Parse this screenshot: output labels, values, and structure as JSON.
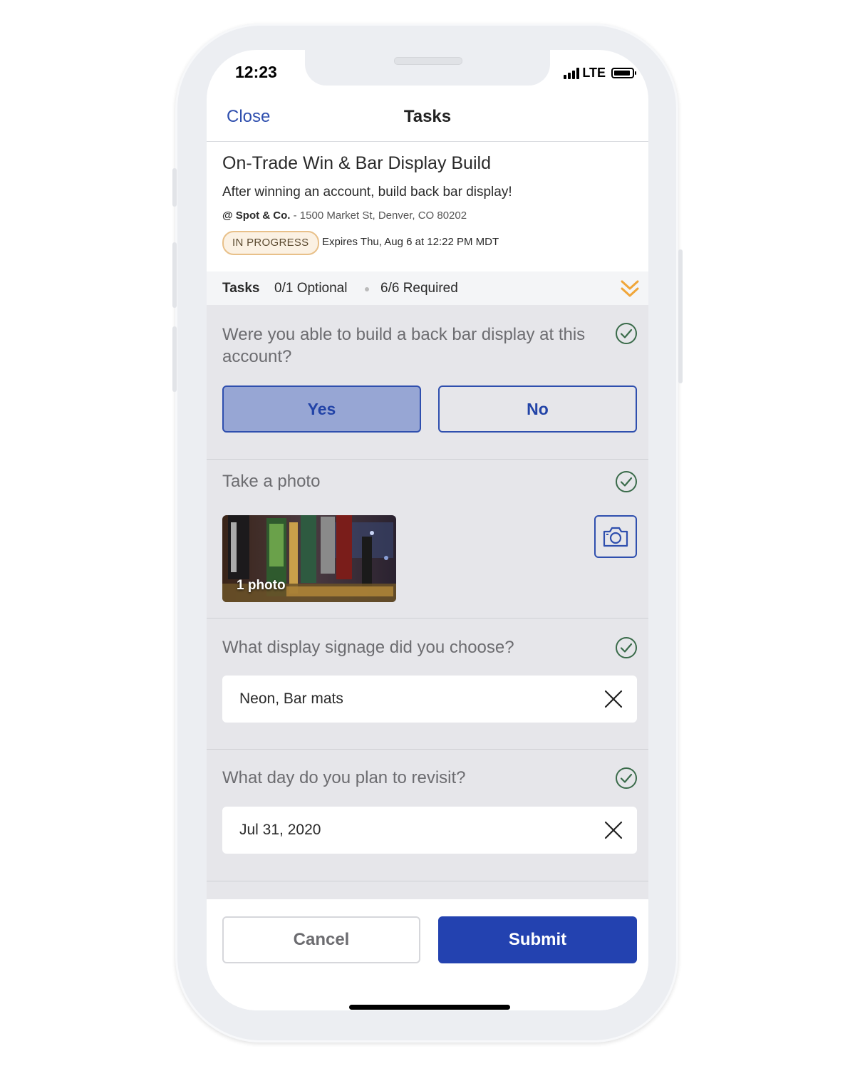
{
  "status_bar": {
    "time": "12:23",
    "network": "LTE"
  },
  "nav": {
    "close_label": "Close",
    "title": "Tasks"
  },
  "task": {
    "title": "On-Trade Win & Bar Display Build",
    "description": "After winning an account, build back bar display!",
    "venue": "@ Spot & Co.",
    "address": "- 1500 Market St, Denver, CO 80202",
    "status": "IN PROGRESS",
    "expires": "Expires Thu, Aug 6 at 12:22 PM MDT"
  },
  "tasks_summary": {
    "label": "Tasks",
    "optional": "0/1 Optional",
    "required": "6/6 Required"
  },
  "questions": [
    {
      "text": "Were you able to build a back bar display at this account?",
      "yes_label": "Yes",
      "no_label": "No",
      "selected": "Yes",
      "completed": true
    },
    {
      "text": "Take a photo",
      "photo_label": "1 photo",
      "completed": true
    },
    {
      "text": "What display signage did you choose?",
      "value": "Neon, Bar mats",
      "completed": true
    },
    {
      "text": "What day do you plan to revisit?",
      "value": "Jul 31, 2020",
      "completed": true
    }
  ],
  "footer": {
    "cancel_label": "Cancel",
    "submit_label": "Submit"
  },
  "colors": {
    "accent": "#2f4fae",
    "submit": "#2342b0",
    "check": "#3a6b4a",
    "badge_border": "#e8c089",
    "chevron": "#f0a63a"
  },
  "icons": [
    "signal-icon",
    "battery-icon",
    "chevron-double-down-icon",
    "check-circle-icon",
    "camera-icon",
    "clear-x-icon"
  ]
}
